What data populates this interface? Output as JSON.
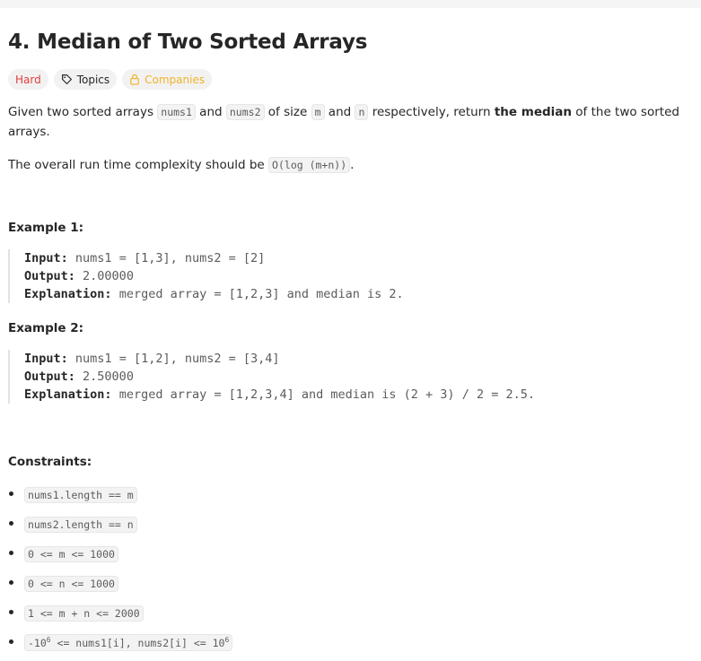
{
  "problem": {
    "title": "4. Median of Two Sorted Arrays",
    "tags": {
      "difficulty": "Hard",
      "topics": "Topics",
      "companies": "Companies"
    },
    "description": {
      "p1": {
        "t1": "Given two sorted arrays ",
        "c1": "nums1",
        "t2": " and ",
        "c2": "nums2",
        "t3": " of size ",
        "c3": "m",
        "t4": " and ",
        "c4": "n",
        "t5": " respectively, return ",
        "bold": "the median",
        "t6": " of the two sorted arrays."
      },
      "p2": {
        "t1": "The overall run time complexity should be ",
        "c1": "O(log (m+n))",
        "t2": "."
      }
    },
    "examples": [
      {
        "title": "Example 1:",
        "input_label": "Input:",
        "input": "nums1 = [1,3], nums2 = [2]",
        "output_label": "Output:",
        "output": "2.00000",
        "explanation_label": "Explanation:",
        "explanation": "merged array = [1,2,3] and median is 2."
      },
      {
        "title": "Example 2:",
        "input_label": "Input:",
        "input": "nums1 = [1,2], nums2 = [3,4]",
        "output_label": "Output:",
        "output": "2.50000",
        "explanation_label": "Explanation:",
        "explanation": "merged array = [1,2,3,4] and median is (2 + 3) / 2 = 2.5."
      }
    ],
    "constraints_title": "Constraints:",
    "constraints": [
      "nums1.length == m",
      "nums2.length == n",
      "0 <= m <= 1000",
      "0 <= n <= 1000",
      "1 <= m + n <= 2000"
    ],
    "last_constraint": {
      "a": "-10",
      "a_exp": "6",
      "b": " <= nums1[i], nums2[i] <= 10",
      "b_exp": "6"
    },
    "colors": {
      "hard": "#e53e3e",
      "companies": "#f0b429",
      "text": "#262626"
    },
    "icons": [
      "tag-icon",
      "lock-icon"
    ]
  }
}
